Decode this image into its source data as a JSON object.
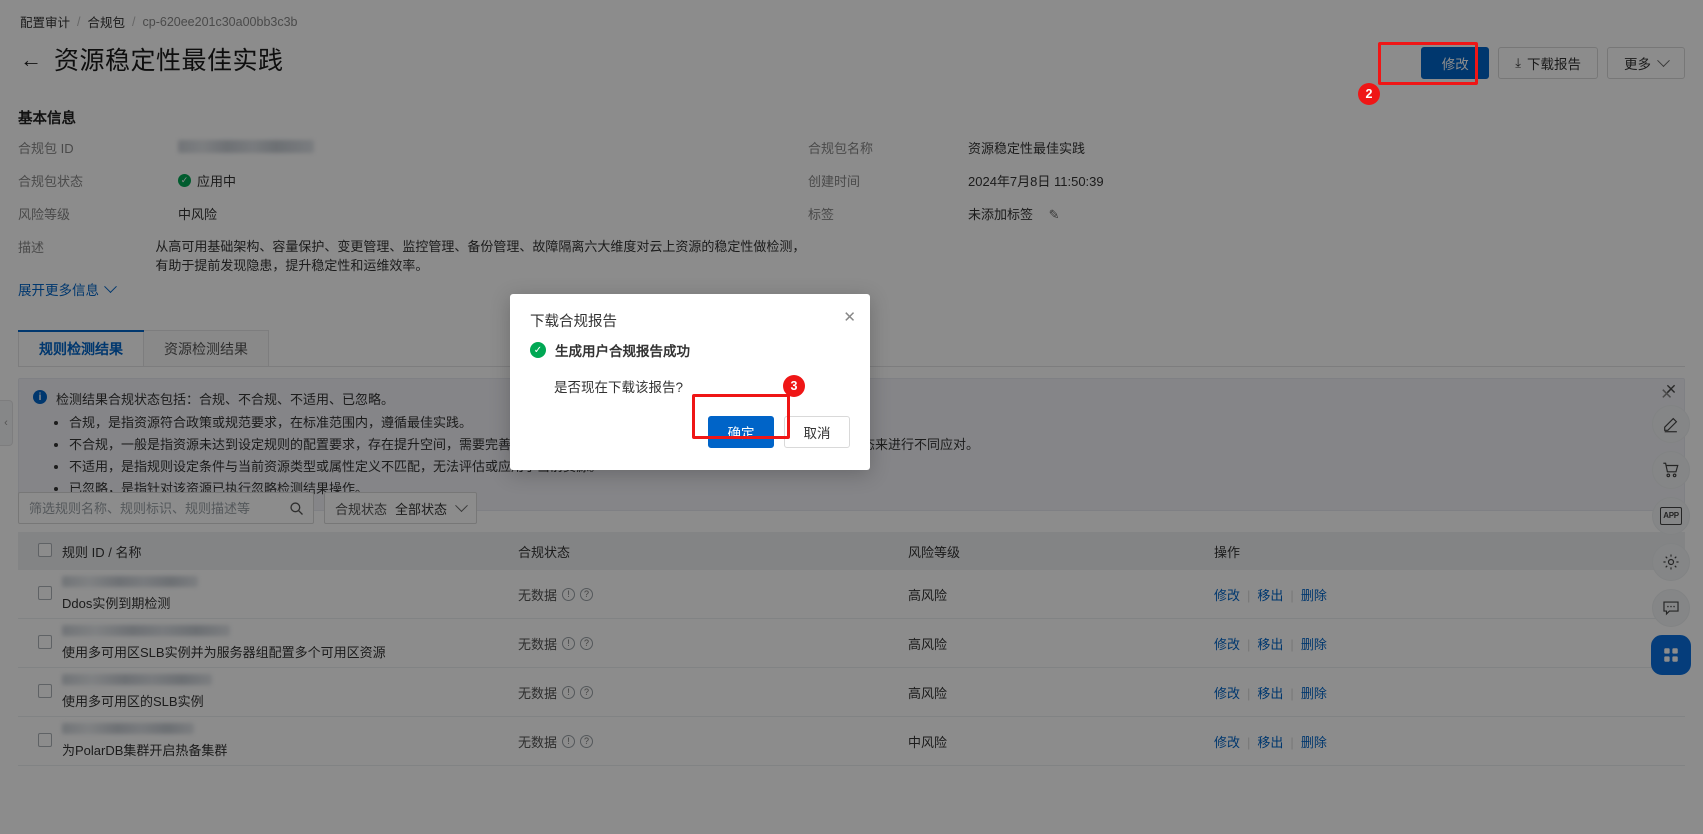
{
  "breadcrumb": {
    "items": [
      {
        "label": "配置审计",
        "muted": false
      },
      {
        "label": "合规包",
        "muted": false
      },
      {
        "label": "cp-620ee201c30a00bb3c3b",
        "muted": true
      }
    ],
    "separator": "/"
  },
  "header": {
    "title": "资源稳定性最佳实践",
    "back_icon": "←",
    "actions": {
      "modify": "修改",
      "download_report": "下载报告",
      "download_icon": "⤓",
      "more": "更多"
    }
  },
  "annotations": [
    {
      "number": "2",
      "target": "download-report-button"
    },
    {
      "number": "3",
      "target": "modal-confirm-button"
    }
  ],
  "basic_info": {
    "heading": "基本信息",
    "rows": [
      {
        "label": "合规包 ID",
        "value": "",
        "redacted": true
      },
      {
        "label": "合规包名称",
        "value": "资源稳定性最佳实践",
        "redacted": false
      },
      {
        "label": "合规包状态",
        "value": "应用中",
        "status": "ok"
      },
      {
        "label": "创建时间",
        "value": "2024年7月8日 11:50:39"
      },
      {
        "label": "风险等级",
        "value": "中风险"
      },
      {
        "label": "标签",
        "value": "未添加标签",
        "edit_icon": "✎"
      },
      {
        "label": "描述",
        "value": "从高可用基础架构、容量保护、变更管理、监控管理、备份管理、故障隔离六大维度对云上资源的稳定性做检测，有助于提前发现隐患，提升稳定性和运维效率。"
      }
    ],
    "expand_more": "展开更多信息"
  },
  "tabs": [
    {
      "label": "规则检测结果",
      "active": true
    },
    {
      "label": "资源检测结果",
      "active": false
    }
  ],
  "alert": {
    "icon": "i",
    "heading": "检测结果合规状态包括：合规、不合规、不适用、已忽略。",
    "bullets": [
      "合规，是指资源符合政策或规范要求，在标准范围内，遵循最佳实践。",
      "不合规，一般是指资源未达到设定规则的配置要求，存在提升空间，需要完善。不合规项包括高风险、中风险、低风险三类，可根据风险状态来进行不同应对。",
      "不适用，是指规则设定条件与当前资源类型或属性定义不匹配，无法评估或应用于当前资源。",
      "已忽略，是指针对该资源已执行忽略检测结果操作。"
    ],
    "close_icon": "✕"
  },
  "filters": {
    "search_placeholder": "筛选规则名称、规则标识、规则描述等",
    "search_value": "",
    "search_icon": "search-icon",
    "status_filter": {
      "label": "合规状态",
      "value": "全部状态"
    }
  },
  "table": {
    "columns": [
      "规则 ID / 名称",
      "合规状态",
      "风险等级",
      "操作"
    ],
    "ops_labels": [
      "修改",
      "移出",
      "删除"
    ],
    "rows": [
      {
        "rule_id_redacted": true,
        "rule_id_width": 136,
        "name": "Ddos实例到期检测",
        "status": "无数据",
        "risk": "高风险"
      },
      {
        "rule_id_redacted": true,
        "rule_id_width": 168,
        "name": "使用多可用区SLB实例并为服务器组配置多个可用区资源",
        "status": "无数据",
        "risk": "高风险"
      },
      {
        "rule_id_redacted": true,
        "rule_id_width": 150,
        "name": "使用多可用区的SLB实例",
        "status": "无数据",
        "risk": "高风险"
      },
      {
        "rule_id_redacted": true,
        "rule_id_width": 132,
        "name": "为PolarDB集群开启热备集群",
        "status": "无数据",
        "risk": "中风险"
      }
    ]
  },
  "modal": {
    "title": "下载合规报告",
    "success_text": "生成用户合规报告成功",
    "question": "是否现在下载该报告?",
    "confirm": "确定",
    "cancel": "取消",
    "close_icon": "✕"
  },
  "right_rail": {
    "close_icon": "✕",
    "items": [
      {
        "icon": "pen-icon"
      },
      {
        "icon": "cart-icon"
      },
      {
        "icon": "app-icon",
        "text": "APP"
      },
      {
        "icon": "gear-icon"
      },
      {
        "icon": "chat-icon"
      },
      {
        "icon": "grid-icon"
      }
    ]
  },
  "left_handle": {
    "icon": "‹"
  },
  "colors": {
    "primary": "#0064c8",
    "success": "#00a854",
    "annotation": "#ef1616"
  }
}
